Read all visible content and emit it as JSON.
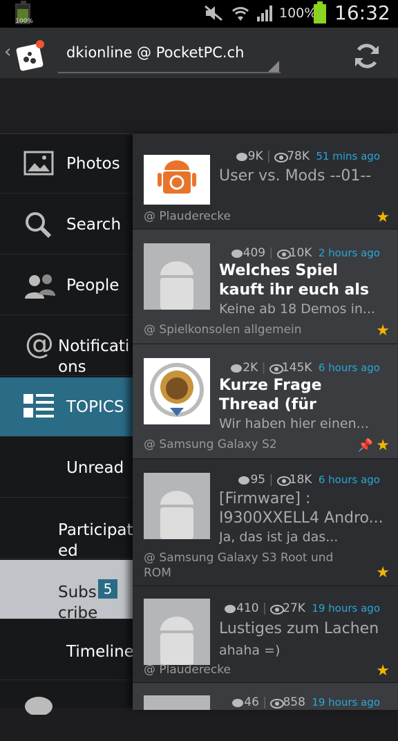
{
  "status": {
    "battery_small": "100%",
    "battery_pct": "100%",
    "time": "16:32"
  },
  "header": {
    "title": "dkionline @ PocketPC.ch"
  },
  "drawer": {
    "items": [
      {
        "label": "Photos"
      },
      {
        "label": "Search"
      },
      {
        "label": "People"
      },
      {
        "label": "Notifications_a",
        "l1": "Notificati",
        "l2": "ons"
      },
      {
        "label": "TOPICS"
      },
      {
        "label": "Unread"
      },
      {
        "l1": "Participat",
        "l2": "ed"
      },
      {
        "l1": "Subs",
        "l2": "cribe",
        "badge": "5"
      },
      {
        "label": "Timeline"
      }
    ]
  },
  "topics": [
    {
      "comments": "9K",
      "views": "78K",
      "ago": "51 mins ago",
      "title": "User vs. Mods --01--",
      "subtitle": "",
      "forum": "@ Plauderecke"
    },
    {
      "comments": "409",
      "views": "10K",
      "ago": "2 hours ago",
      "title": "Welches Spiel kauft ihr euch als",
      "subtitle": "Keine ab 18 Demos in...",
      "forum": "@ Spielkonsolen allgemein"
    },
    {
      "comments": "2K",
      "views": "145K",
      "ago": "6 hours ago",
      "title": "Kurze Frage Thread (für Anfänger und...",
      "subtitle": "Wir haben hier einen...",
      "forum": "@ Samsung Galaxy S2"
    },
    {
      "comments": "95",
      "views": "18K",
      "ago": "6 hours ago",
      "title": "[Firmware] : I9300XXELL4 Andro...",
      "subtitle": "Ja, das ist ja das...",
      "forum": "@ Samsung Galaxy S3 Root und ROM"
    },
    {
      "comments": "410",
      "views": "27K",
      "ago": "19 hours ago",
      "title": "Lustiges zum Lachen",
      "subtitle": "ahaha =)",
      "forum": "@ Plauderecke"
    },
    {
      "comments": "46",
      "views": "858",
      "ago": "19 hours ago",
      "title": "",
      "subtitle": "",
      "forum": ""
    }
  ]
}
